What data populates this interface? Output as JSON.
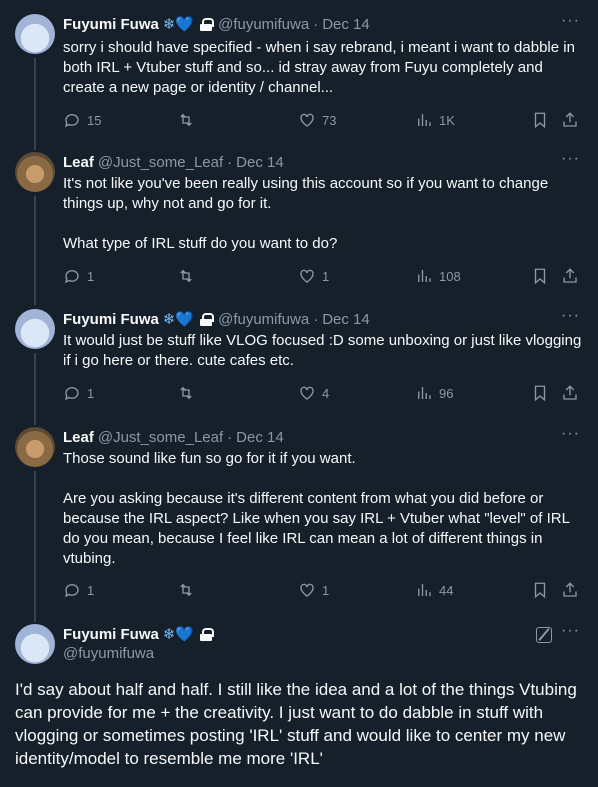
{
  "tweets": [
    {
      "name": "Fuyumi Fuwa",
      "badges": "❄💙",
      "handle": "@fuyumifuwa",
      "date": "Dec 14",
      "text": "sorry i should have specified - when i say rebrand, i meant i want to dabble in both IRL + Vtuber stuff and so... id stray away from Fuyu completely and create a new page or identity / channel...",
      "replies": "15",
      "retweets": "",
      "likes": "73",
      "views": "1K"
    },
    {
      "name": "Leaf",
      "handle": "@Just_some_Leaf",
      "date": "Dec 14",
      "text": "It's not like you've been really using this account so if you want to change things up, why not and go for it.\n\nWhat type of IRL stuff do you want to do?",
      "replies": "1",
      "retweets": "",
      "likes": "1",
      "views": "108"
    },
    {
      "name": "Fuyumi Fuwa",
      "badges": "❄💙",
      "handle": "@fuyumifuwa",
      "date": "Dec 14",
      "text": "It would just be stuff like VLOG focused :D some unboxing or just like vlogging if i go here or there. cute cafes etc.",
      "replies": "1",
      "retweets": "",
      "likes": "4",
      "views": "96"
    },
    {
      "name": "Leaf",
      "handle": "@Just_some_Leaf",
      "date": "Dec 14",
      "text": "Those sound like fun so go for it if you want.\n\nAre you asking because it's different content from what you did before or because the IRL aspect? Like when you say IRL + Vtuber what \"level\" of IRL do you mean, because I feel like IRL can mean a lot of different things in vtubing.",
      "replies": "1",
      "retweets": "",
      "likes": "1",
      "views": "44"
    }
  ],
  "main": {
    "name": "Fuyumi Fuwa",
    "badges": "❄💙",
    "handle": "@fuyumifuwa",
    "text": "I'd say about half and half. I still like the idea and a lot of the things Vtubing can provide for me + the creativity. I just want to do dabble in stuff with vlogging or sometimes posting 'IRL' stuff and would like to center my new identity/model to resemble me more 'IRL'"
  },
  "colors": {
    "background": "#15202b",
    "secondary_text": "#8b98a5",
    "badge_blue": "#7ab8f0"
  }
}
